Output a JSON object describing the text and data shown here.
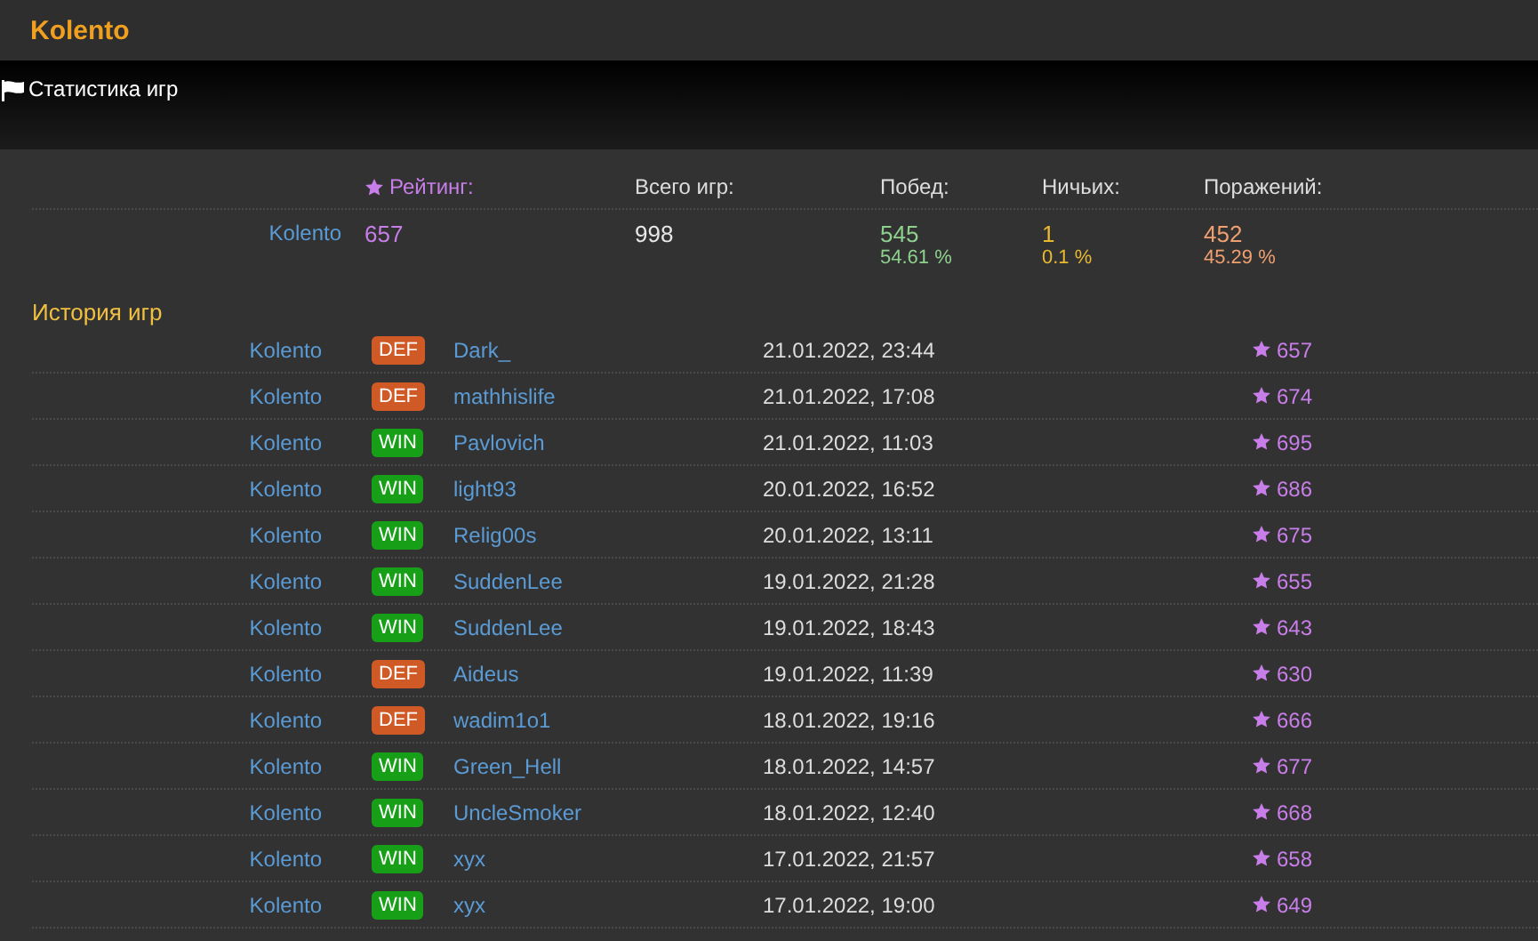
{
  "header": {
    "title": "Kolento"
  },
  "section": {
    "title": "Статистика игр"
  },
  "stats": {
    "labels": {
      "rating": "Рейтинг:",
      "total": "Всего игр:",
      "wins": "Побед:",
      "draws": "Ничьих:",
      "losses": "Поражений:"
    },
    "player": "Kolento",
    "rating": "657",
    "total": "998",
    "wins": "545",
    "wins_pct": "54.61 %",
    "draws": "1",
    "draws_pct": "0.1 %",
    "losses": "452",
    "losses_pct": "45.29 %"
  },
  "history": {
    "title": "История игр",
    "rows": [
      {
        "player": "Kolento",
        "result": {
          "kind": "def",
          "label": "DEF"
        },
        "opponent": "Dark_",
        "date": "21.01.2022, 23:44",
        "rating": "657"
      },
      {
        "player": "Kolento",
        "result": {
          "kind": "def",
          "label": "DEF"
        },
        "opponent": "mathhislife",
        "date": "21.01.2022, 17:08",
        "rating": "674"
      },
      {
        "player": "Kolento",
        "result": {
          "kind": "win",
          "label": "WIN"
        },
        "opponent": "Pavlovich",
        "date": "21.01.2022, 11:03",
        "rating": "695"
      },
      {
        "player": "Kolento",
        "result": {
          "kind": "win",
          "label": "WIN"
        },
        "opponent": "light93",
        "date": "20.01.2022, 16:52",
        "rating": "686"
      },
      {
        "player": "Kolento",
        "result": {
          "kind": "win",
          "label": "WIN"
        },
        "opponent": "Relig00s",
        "date": "20.01.2022, 13:11",
        "rating": "675"
      },
      {
        "player": "Kolento",
        "result": {
          "kind": "win",
          "label": "WIN"
        },
        "opponent": "SuddenLee",
        "date": "19.01.2022, 21:28",
        "rating": "655"
      },
      {
        "player": "Kolento",
        "result": {
          "kind": "win",
          "label": "WIN"
        },
        "opponent": "SuddenLee",
        "date": "19.01.2022, 18:43",
        "rating": "643"
      },
      {
        "player": "Kolento",
        "result": {
          "kind": "def",
          "label": "DEF"
        },
        "opponent": "Aideus",
        "date": "19.01.2022, 11:39",
        "rating": "630"
      },
      {
        "player": "Kolento",
        "result": {
          "kind": "def",
          "label": "DEF"
        },
        "opponent": "wadim1o1",
        "date": "18.01.2022, 19:16",
        "rating": "666"
      },
      {
        "player": "Kolento",
        "result": {
          "kind": "win",
          "label": "WIN"
        },
        "opponent": "Green_Hell",
        "date": "18.01.2022, 14:57",
        "rating": "677"
      },
      {
        "player": "Kolento",
        "result": {
          "kind": "win",
          "label": "WIN"
        },
        "opponent": "UncleSmoker",
        "date": "18.01.2022, 12:40",
        "rating": "668"
      },
      {
        "player": "Kolento",
        "result": {
          "kind": "win",
          "label": "WIN"
        },
        "opponent": "xyx",
        "date": "17.01.2022, 21:57",
        "rating": "658"
      },
      {
        "player": "Kolento",
        "result": {
          "kind": "win",
          "label": "WIN"
        },
        "opponent": "xyx",
        "date": "17.01.2022, 19:00",
        "rating": "649"
      }
    ]
  }
}
